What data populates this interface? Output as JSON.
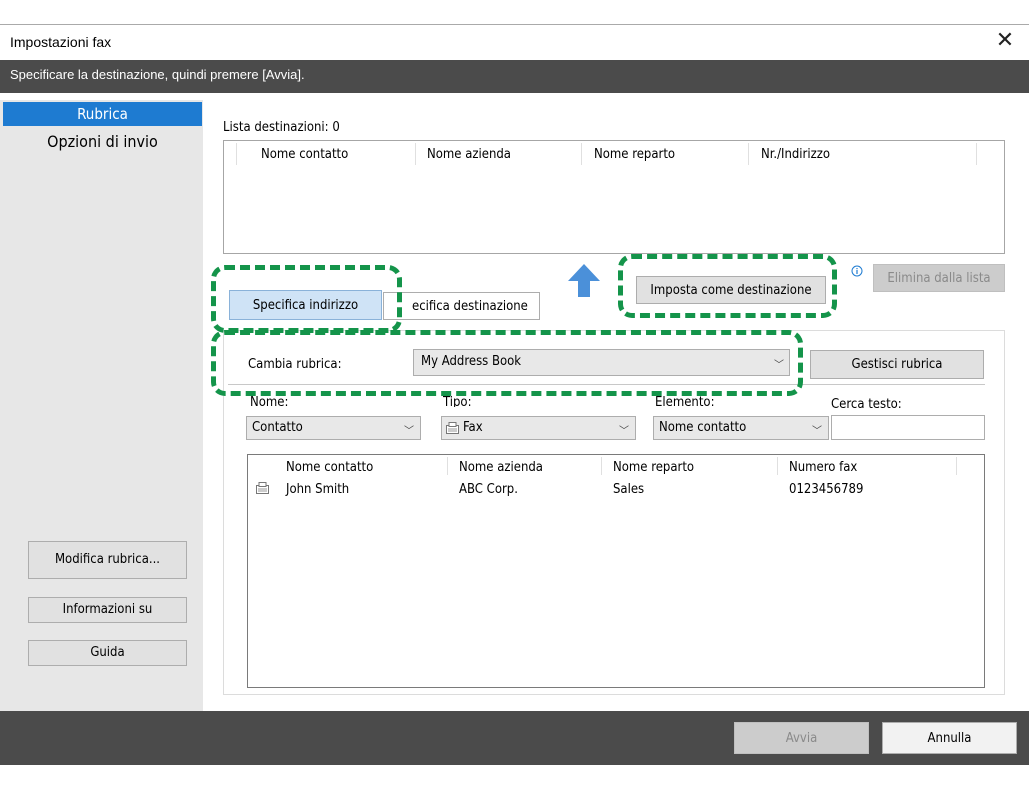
{
  "window": {
    "title": "Impostazioni fax",
    "close": "✕"
  },
  "instruction": "Specificare la destinazione, quindi premere [Avvia].",
  "nav": {
    "active": "Rubrica",
    "second": "Opzioni di invio"
  },
  "left_buttons": {
    "edit": "Modifica rubrica...",
    "info": "Informazioni su",
    "help": "Guida"
  },
  "dest": {
    "label": "Lista destinazioni: 0",
    "columns": [
      "Nome contatto",
      "Nome azienda",
      "Nome reparto",
      "Nr./Indirizzo"
    ]
  },
  "tabs": {
    "specify_address": "Specifica indirizzo",
    "specify_destination": "Specifica destinazione",
    "specify_destination_visible": "ecifica destinazione"
  },
  "buttons": {
    "set_destination": "Imposta come destinazione",
    "remove_from_list": "Elimina dalla lista",
    "manage_addressbook": "Gestisci rubrica",
    "start": "Avvia",
    "cancel": "Annulla"
  },
  "addressbook": {
    "label": "Cambia rubrica:",
    "selected": "My Address Book"
  },
  "filters": {
    "name_label": "Nome:",
    "name_value": "Contatto",
    "type_label": "Tipo:",
    "type_value": "Fax",
    "element_label": "Elemento:",
    "element_value": "Nome contatto",
    "search_label": "Cerca testo:",
    "search_value": ""
  },
  "contacts": {
    "columns": [
      "Nome contatto",
      "Nome azienda",
      "Nome reparto",
      "Numero fax"
    ],
    "rows": [
      {
        "name": "John Smith",
        "company": "ABC Corp.",
        "department": "Sales",
        "fax": "0123456789"
      }
    ]
  },
  "icons": {
    "up_arrow": "arrow-up-icon",
    "info": "info-icon",
    "fax": "fax-icon"
  },
  "colors": {
    "accent": "#1e7bd1",
    "dash": "#14944a",
    "dark_bar": "#4b4b4b",
    "arrow": "#4b90d9"
  }
}
